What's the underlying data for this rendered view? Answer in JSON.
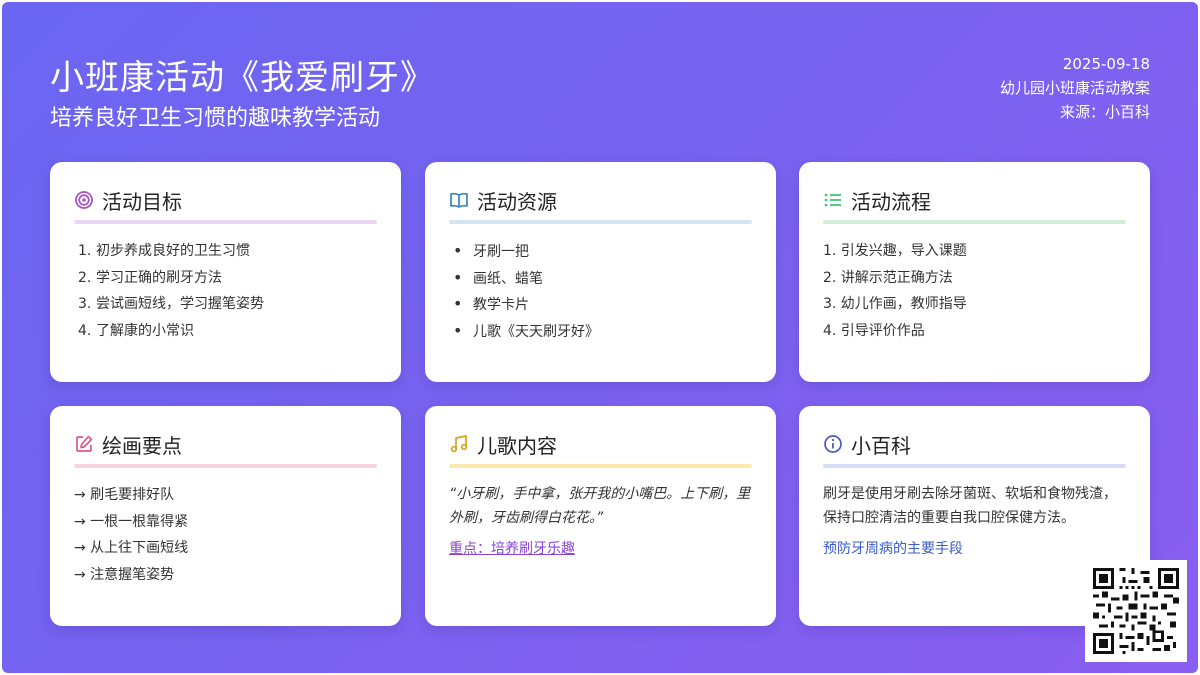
{
  "header": {
    "title": "小班康活动《我爱刷牙》",
    "subtitle": "培养良好卫生习惯的趣味教学活动",
    "date": "2025-09-18",
    "category": "幼儿园小班康活动教案",
    "source": "来源：小百科"
  },
  "colors": {
    "background_start": "#6a66f2",
    "background_end": "#8a5ef0",
    "goals_accent": "#a855c8",
    "resources_accent": "#3b82c4",
    "process_accent": "#3cbf6e",
    "drawing_accent": "#e0568f",
    "song_accent": "#d8a21a",
    "wiki_accent": "#4a58c8"
  },
  "cards": {
    "goals": {
      "icon": "target-icon",
      "title": "活动目标",
      "items": [
        {
          "num": "1.",
          "text": "初步养成良好的卫生习惯"
        },
        {
          "num": "2.",
          "text": "学习正确的刷牙方法"
        },
        {
          "num": "3.",
          "text": "尝试画短线，学习握笔姿势"
        },
        {
          "num": "4.",
          "text": "了解康的小常识"
        }
      ]
    },
    "resources": {
      "icon": "book-icon",
      "title": "活动资源",
      "items": [
        "牙刷一把",
        "画纸、蜡笔",
        "教学卡片",
        "儿歌《天天刷牙好》"
      ]
    },
    "process": {
      "icon": "list-icon",
      "title": "活动流程",
      "items": [
        "1. 引发兴趣，导入课题",
        "2. 讲解示范正确方法",
        "3. 幼儿作画，教师指导",
        "4. 引导评价作品"
      ]
    },
    "drawing": {
      "icon": "edit-icon",
      "title": "绘画要点",
      "items": [
        "→ 刷毛要排好队",
        "→ 一根一根靠得紧",
        "→ 从上往下画短线",
        "→ 注意握笔姿势"
      ]
    },
    "song": {
      "icon": "music-icon",
      "title": "儿歌内容",
      "lyrics": "“小牙刷，手中拿，张开我的小嘴巴。上下刷，里外刷，牙齿刷得白花花。”",
      "link": "重点：培养刷牙乐趣"
    },
    "wiki": {
      "icon": "info-icon",
      "title": "小百科",
      "text": "刷牙是使用牙刷去除牙菌斑、软垢和食物残渣，保持口腔清洁的重要自我口腔保健方法。",
      "link": "预防牙周病的主要手段"
    }
  },
  "qr": {
    "icon": "qr-code-icon"
  }
}
